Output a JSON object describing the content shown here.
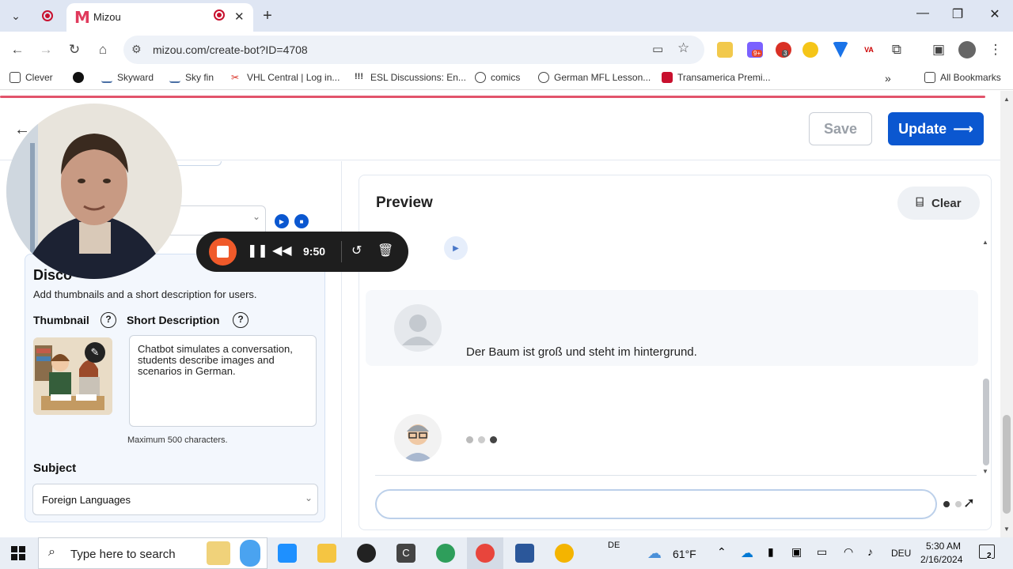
{
  "browser": {
    "tab_title": "Mizou",
    "url": "mizou.com/create-bot?ID=4708",
    "bookmarks": [
      "Clever",
      "Skyward",
      "Sky fin",
      "VHL Central | Log in...",
      "ESL Discussions: En...",
      "comics",
      "German MFL Lesson...",
      "Transamerica Premi..."
    ],
    "all_bookmarks": "All Bookmarks",
    "ext_badge_1": "9+",
    "ext_badge_2": "3"
  },
  "header": {
    "save_label": "Save",
    "update_label": "Update"
  },
  "left": {
    "card_title": "Disco",
    "card_subtitle": "Add thumbnails and a short description for users.",
    "thumbnail_label": "Thumbnail",
    "short_desc_label": "Short Description",
    "short_desc_value": "Chatbot simulates a conversation, students describe images and scenarios in German.",
    "max_chars": "Maximum 500 characters.",
    "subject_label": "Subject",
    "subject_value": "Foreign Languages"
  },
  "preview": {
    "title": "Preview",
    "clear_label": "Clear",
    "user_message": "Der Baum ist groß und steht im hintergrund."
  },
  "recorder": {
    "time": "9:50"
  },
  "taskbar": {
    "search_placeholder": "Type here to search",
    "lang_indicator": "DE",
    "weather": "61°F",
    "keyboard": "DEU",
    "time": "5:30 AM",
    "date": "2/16/2024",
    "notifications": "2"
  }
}
